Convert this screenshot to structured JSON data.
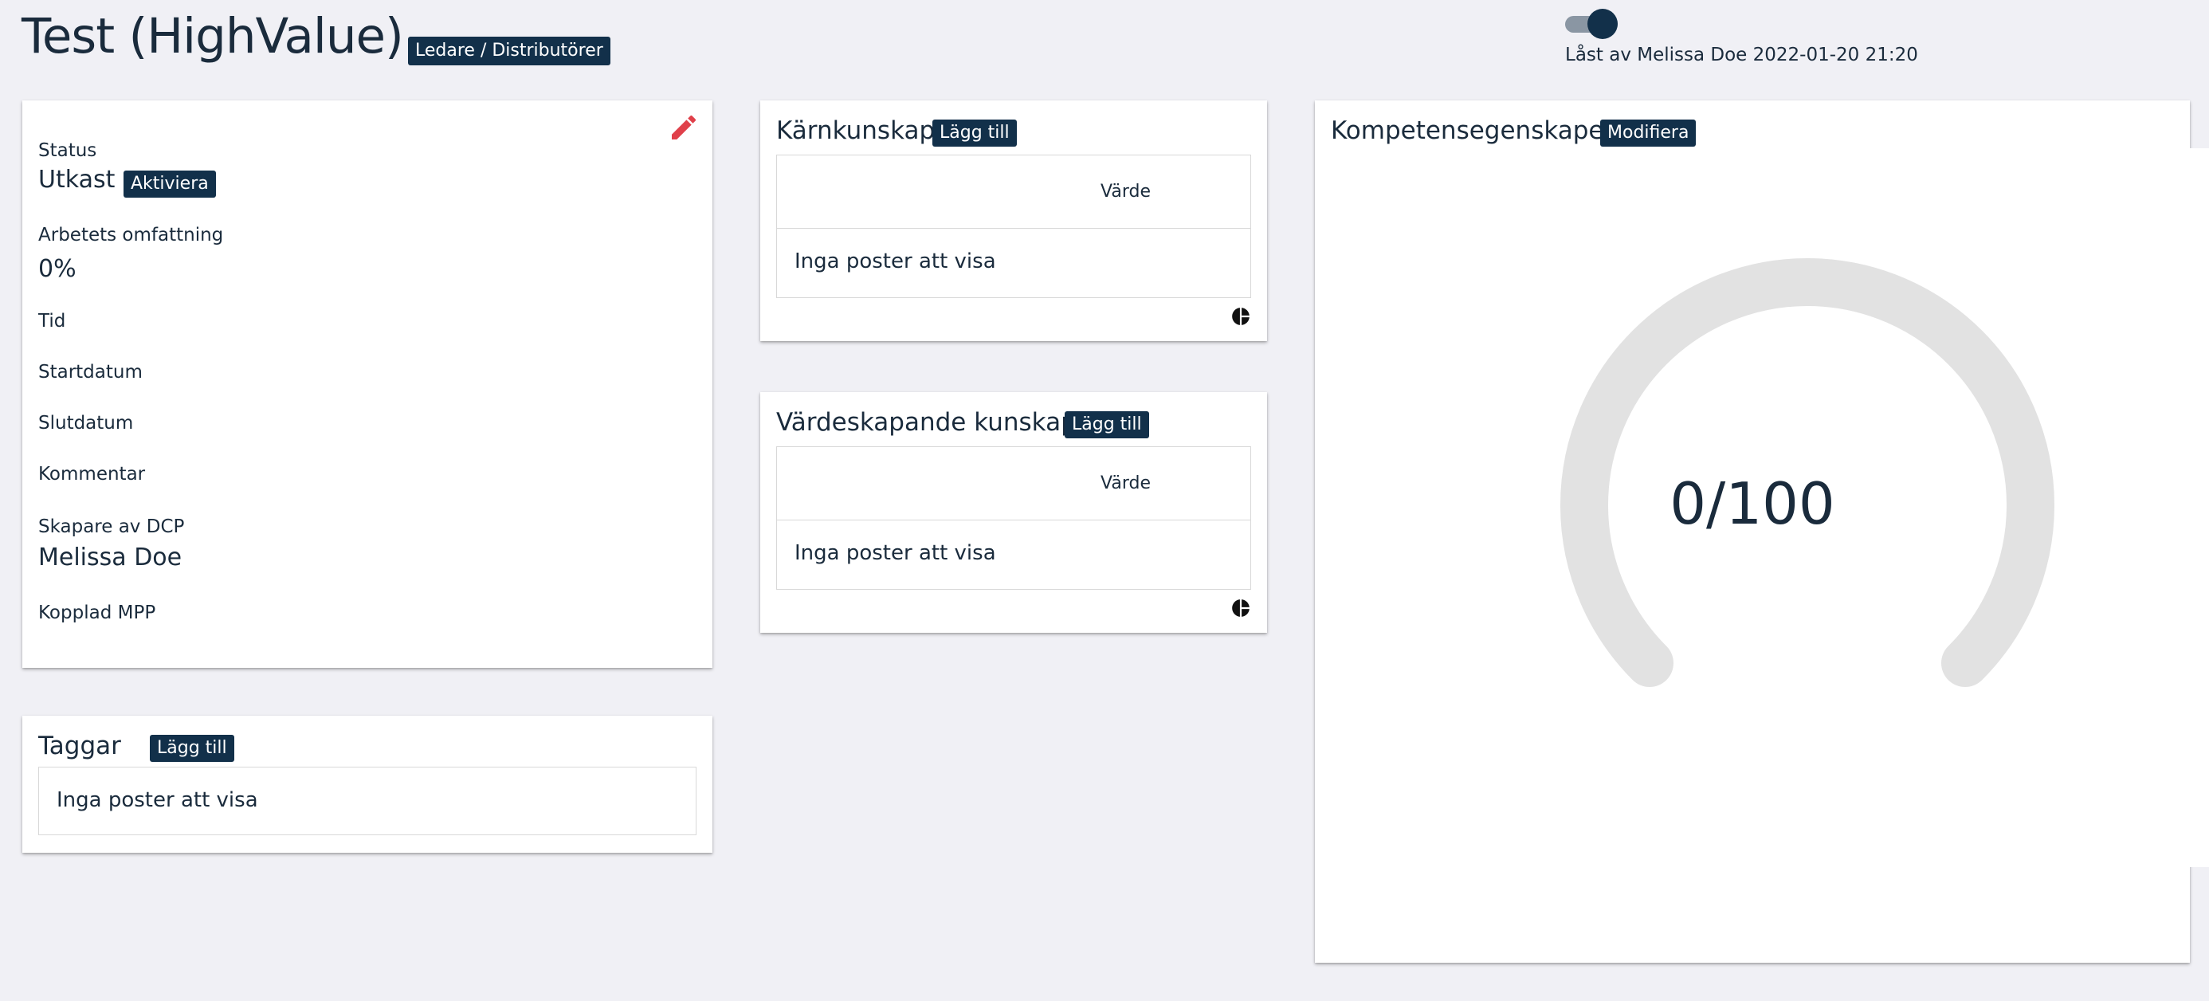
{
  "header": {
    "title": "Test (HighValue)",
    "badge": "Ledare / Distributörer",
    "locked_text": "Låst av Melissa Doe 2022-01-20 21:20"
  },
  "info": {
    "status_label": "Status",
    "status_value": "Utkast",
    "activate_button": "Aktiviera",
    "scope_label": "Arbetets omfattning",
    "scope_value": "0%",
    "time_label": "Tid",
    "start_label": "Startdatum",
    "end_label": "Slutdatum",
    "comment_label": "Kommentar",
    "creator_label": "Skapare av DCP",
    "creator_value": "Melissa Doe",
    "mpp_label": "Kopplad MPP"
  },
  "tags": {
    "title": "Taggar",
    "add_button": "Lägg till",
    "empty": "Inga poster att visa"
  },
  "core": {
    "title": "Kärnkunskap",
    "add_button": "Lägg till",
    "column": "Värde",
    "empty": "Inga poster att visa"
  },
  "value_creating": {
    "title": "Värdeskapande kunskap",
    "add_button": "Lägg till",
    "column": "Värde",
    "empty": "Inga poster att visa"
  },
  "competence": {
    "title": "Kompetensegenskaper",
    "modify_button": "Modifiera",
    "score_text": "0/100",
    "score": 0,
    "max": 100
  },
  "colors": {
    "background": "#f0f0f5",
    "primary": "#12304a",
    "edit_icon": "#e0404a",
    "gauge_track": "#e2e2e2"
  }
}
